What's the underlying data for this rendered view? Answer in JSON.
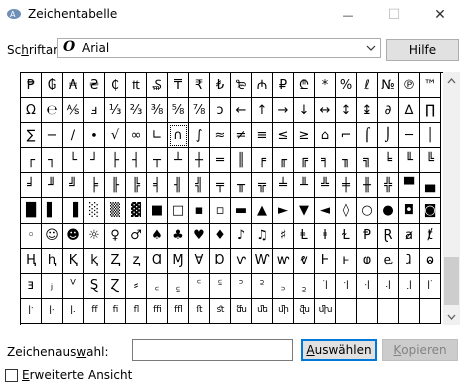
{
  "window": {
    "title": "Zeichentabelle",
    "minimize_glyph": "—",
    "maximize_glyph": "☐",
    "close_glyph": "✕"
  },
  "font": {
    "label_pre": "Sc",
    "label_mn": "h",
    "label_post": "riftart:",
    "icon_glyph": "O",
    "selected": "Arial"
  },
  "help_button": "Hilfe",
  "grid_chars": [
    "₱",
    "₲",
    "₳",
    "₴",
    "₵",
    "₶",
    "₷",
    "₸",
    "₹",
    "₺",
    "₻",
    "₼",
    "₽",
    "₾",
    "*",
    "%",
    "ℓ",
    "№",
    "℗",
    "™",
    "Ω",
    "℮",
    "⅍",
    "ⅎ",
    "⅓",
    "⅔",
    "⅜",
    "⅝",
    "⅞",
    "ↄ",
    "←",
    "↑",
    "→",
    "↓",
    "↔",
    "↕",
    "↨",
    "∂",
    "∆",
    "∏",
    "∑",
    "−",
    "∕",
    "∙",
    "√",
    "∞",
    "∟",
    "∩",
    "∫",
    "≈",
    "≠",
    "≡",
    "≤",
    "≥",
    "⌂",
    "⌐",
    "⌠",
    "⌡",
    "─",
    "│",
    "┌",
    "┐",
    "└",
    "┘",
    "├",
    "┤",
    "┬",
    "┴",
    "┼",
    "═",
    "║",
    "╒",
    "╓",
    "╔",
    "╕",
    "╖",
    "╗",
    "╘",
    "╙",
    "╚",
    "╛",
    "╜",
    "╝",
    "╞",
    "╟",
    "╠",
    "╡",
    "╢",
    "╣",
    "╤",
    "╥",
    "╦",
    "╧",
    "╨",
    "╩",
    "╪",
    "╫",
    "╬",
    "▀",
    "▄",
    "█",
    "▌",
    "▐",
    "░",
    "▒",
    "▓",
    "■",
    "□",
    "▪",
    "▫",
    "▬",
    "▲",
    "►",
    "▼",
    "◄",
    "◊",
    "○",
    "●",
    "◘",
    "◙",
    "◦",
    "☺",
    "☻",
    "☼",
    "♀",
    "♂",
    "♠",
    "♣",
    "♥",
    "♦",
    "♪",
    "♫",
    "♯",
    "Ⱡ",
    "ⱡ",
    "Ɫ",
    "Ᵽ",
    "Ɽ",
    "ⱥ",
    "ⱦ",
    "Ⱨ",
    "ⱨ",
    "Ⱪ",
    "ⱪ",
    "Ⱬ",
    "ⱬ",
    "Ɑ",
    "Ɱ",
    "Ɐ",
    "Ɒ",
    "ⱱ",
    "Ⱳ",
    "ⱳ",
    "ⱴ",
    "Ⱶ",
    "ⱶ",
    "ⱷ",
    "ⱸ",
    "ⱹ",
    "ⱺ",
    "ⱻ",
    "ⱼ",
    "ⱽ",
    "Ȿ",
    "Ɀ",
    "⸗",
    "꜀",
    "꜁",
    "꜂",
    "꜃",
    "꜄",
    "꜅",
    "꜆",
    "꜇",
    "꜈",
    "꜉",
    "꜊",
    "꜋",
    "꜌",
    "꜍",
    "꜎",
    "꜏",
    "꜐",
    "ﬀ",
    "ﬁ",
    "ﬂ",
    "ﬃ",
    "ﬄ",
    "ﬅ",
    "ﬆ",
    "ﬓ",
    "ﬔ",
    "ﬕ",
    "ﬖ",
    "ﬗ",
    "",
    "",
    "",
    "",
    ""
  ],
  "selection": {
    "label_pre": "Zeichenaus",
    "label_mn": "w",
    "label_post": "ahl:",
    "value": ""
  },
  "select_button": {
    "pre": "",
    "mn": "A",
    "post": "uswählen"
  },
  "copy_button": {
    "pre": "",
    "mn": "K",
    "post": "opieren"
  },
  "advanced": {
    "pre": "",
    "mn": "E",
    "post": "rweiterte Ansicht"
  }
}
